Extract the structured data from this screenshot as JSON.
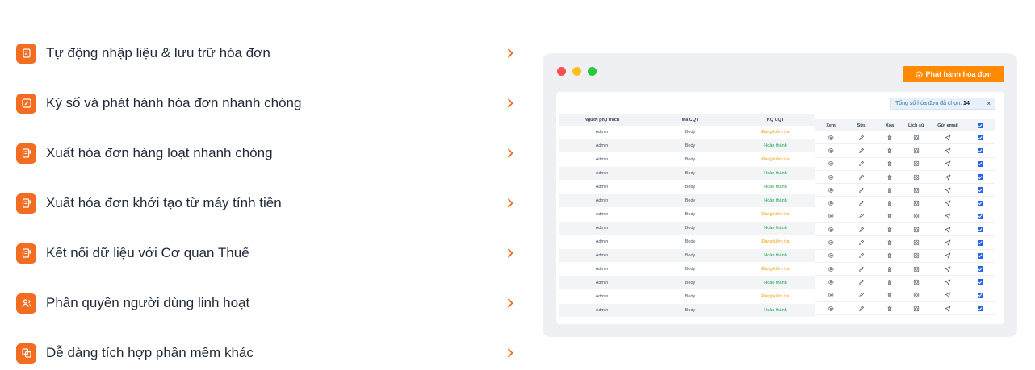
{
  "features": [
    {
      "label": "Tự động nhập liệu & lưu trữ hóa đơn",
      "icon": "document-icon"
    },
    {
      "label": "Ký số và phát hành hóa đơn nhanh chóng",
      "icon": "pen-sign-icon"
    },
    {
      "label": "Xuất hóa đơn hàng loạt nhanh chóng",
      "icon": "invoice-export-icon"
    },
    {
      "label": "Xuất hóa đơn khởi tạo từ máy tính tiền",
      "icon": "invoice-export-icon"
    },
    {
      "label": "Kết nối dữ liệu với Cơ quan Thuế",
      "icon": "invoice-export-icon"
    },
    {
      "label": "Phân quyền người dùng linh hoạt",
      "icon": "users-icon"
    },
    {
      "label": "Dễ dàng tích hợp phần mềm khác",
      "icon": "integration-icon"
    }
  ],
  "window": {
    "issue_button": "Phát hành hóa đơn",
    "selected_label": "Tổng số hóa đơn đã chọn:",
    "selected_count": "14",
    "close_symbol": "×",
    "left_headers": [
      "Người phụ trách",
      "Mã CQT",
      "KQ CQT"
    ],
    "right_headers": [
      "Xem",
      "Sửa",
      "Xóa",
      "Lịch sử",
      "Gửi email"
    ],
    "rows": [
      {
        "owner": "Admin",
        "code": "Body",
        "status": "Đang kiểm tra",
        "kind": "warn"
      },
      {
        "owner": "Admin",
        "code": "Body",
        "status": "Hoàn thành",
        "kind": "ok"
      },
      {
        "owner": "Admin",
        "code": "Body",
        "status": "Đang kiểm tra",
        "kind": "warn"
      },
      {
        "owner": "Admin",
        "code": "Body",
        "status": "Hoàn thành",
        "kind": "ok"
      },
      {
        "owner": "Admin",
        "code": "Body",
        "status": "Hoàn thành",
        "kind": "ok"
      },
      {
        "owner": "Admin",
        "code": "Body",
        "status": "Hoàn thành",
        "kind": "ok"
      },
      {
        "owner": "Admin",
        "code": "Body",
        "status": "Đang kiểm tra",
        "kind": "warn"
      },
      {
        "owner": "Admin",
        "code": "Body",
        "status": "Hoàn thành",
        "kind": "ok"
      },
      {
        "owner": "Admin",
        "code": "Body",
        "status": "Đang kiểm tra",
        "kind": "warn"
      },
      {
        "owner": "Admin",
        "code": "Body",
        "status": "Hoàn thành",
        "kind": "ok"
      },
      {
        "owner": "Admin",
        "code": "Body",
        "status": "Đang kiểm tra",
        "kind": "warn"
      },
      {
        "owner": "Admin",
        "code": "Body",
        "status": "Hoàn thành",
        "kind": "ok"
      },
      {
        "owner": "Admin",
        "code": "Body",
        "status": "Đang kiểm tra",
        "kind": "warn"
      },
      {
        "owner": "Admin",
        "code": "Body",
        "status": "Hoàn thành",
        "kind": "ok"
      }
    ],
    "action_rows": 14
  },
  "colors": {
    "accent": "#f26d21",
    "button": "#ff8a00",
    "status_warn": "#f59e0b",
    "status_ok": "#16a34a",
    "checkbox": "#2563eb"
  }
}
